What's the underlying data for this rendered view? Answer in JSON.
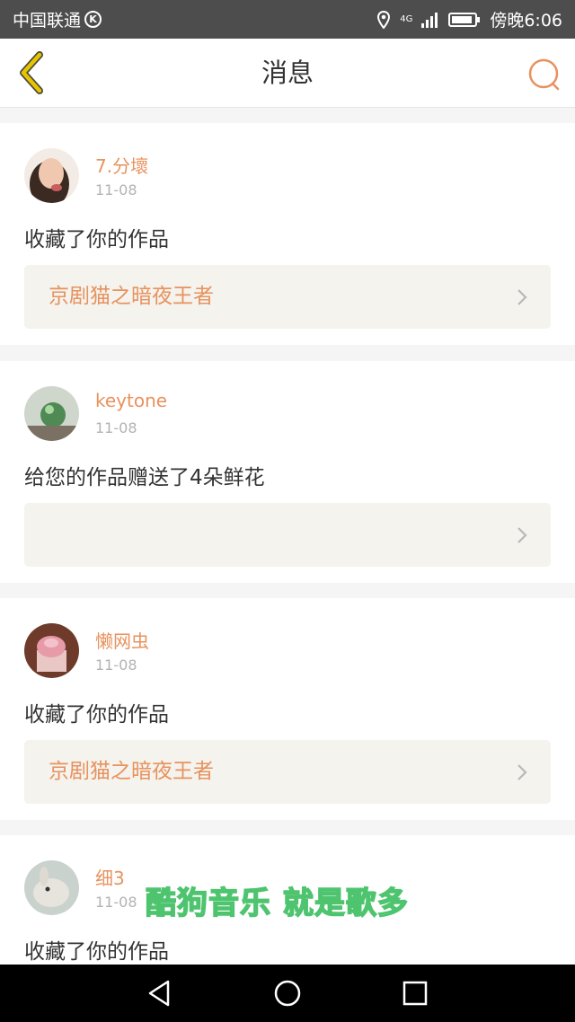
{
  "status_bar": {
    "carrier": "中国联通",
    "carrier_badge": "K",
    "network": "4G",
    "time": "傍晚6:06"
  },
  "header": {
    "title": "消息"
  },
  "messages": [
    {
      "username": "7.分壞",
      "date": "11-08",
      "action": "收藏了你的作品",
      "work_title": "京剧猫之暗夜王者"
    },
    {
      "username": "keytone",
      "date": "11-08",
      "action": "给您的作品赠送了4朵鲜花",
      "work_title": ""
    },
    {
      "username": "懒网虫",
      "date": "11-08",
      "action": "收藏了你的作品",
      "work_title": "京剧猫之暗夜王者"
    },
    {
      "username": "细3",
      "date": "11-08",
      "action": "收藏了你的作品",
      "work_title": ""
    }
  ],
  "watermark": "酷狗音乐 就是歌多",
  "colors": {
    "accent": "#e8925e",
    "status_bar": "#4d4d4d",
    "link_bg": "#f4f3ee",
    "back_arrow": "#e8c400"
  },
  "icons": [
    "back-arrow-icon",
    "search-icon",
    "chevron-right-icon",
    "location-icon",
    "signal-icon",
    "battery-icon",
    "back-triangle-icon",
    "home-circle-icon",
    "recents-square-icon"
  ]
}
